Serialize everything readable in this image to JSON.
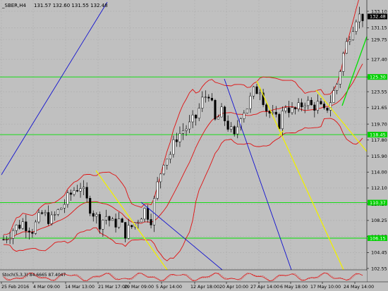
{
  "window": {
    "symbol_header": "_SBER,H4",
    "ohlc": "131.57 132.60 131.55 132.48",
    "current_price_label": "132.48"
  },
  "colors": {
    "background": "#c0c0c0",
    "grid": "#a9a9a9",
    "bull_candle": "#ffffff",
    "bear_candle": "#000000",
    "bollinger": "#e01010",
    "horizontal_levels": "#00e000",
    "trendline_blue": "#1010d0",
    "trendline_yellow": "#f0f000",
    "trendline_green": "#00e000",
    "price_label_bg": "#000000",
    "level_label_bg": "#00d000"
  },
  "price_axis": {
    "ticks": [
      "133.10",
      "131.15",
      "129.75",
      "127.40",
      "125.30",
      "123.55",
      "121.65",
      "119.70",
      "117.80",
      "115.90",
      "114.00",
      "112.10",
      "110.20",
      "108.25",
      "106.35",
      "104.45",
      "102.55"
    ],
    "level_labels": [
      "125.30",
      "118.45",
      "110.37",
      "106.15"
    ]
  },
  "time_axis": {
    "labels": [
      "25 Feb 2016",
      "4 Mar 09:00",
      "14 Mar 13:00",
      "21 Mar 17:00",
      "29 Mar 09:00",
      "5 Apr 14:00",
      "12 Apr 18:00",
      "20 Apr 10:00",
      "27 Apr 14:00",
      "6 May 18:00",
      "17 May 10:00",
      "24 May 14:00"
    ]
  },
  "subwindow": {
    "title": "Stoch(5,3,3) 84.6665 87.4047"
  },
  "chart_data": {
    "type": "candlestick",
    "title": "_SBER,H4",
    "ylim": [
      102.0,
      135.0
    ],
    "y_ticks": [
      133.1,
      131.15,
      129.75,
      127.4,
      125.3,
      123.55,
      121.65,
      119.7,
      117.8,
      115.9,
      114.0,
      112.1,
      110.2,
      108.25,
      106.35,
      104.45,
      102.55
    ],
    "horizontal_levels": [
      125.3,
      118.45,
      110.37,
      106.15
    ],
    "last_price": 132.48,
    "close_path": [
      [
        0,
        106.0
      ],
      [
        3,
        107.2
      ],
      [
        6,
        108.0
      ],
      [
        9,
        107.2
      ],
      [
        12,
        109.0
      ],
      [
        15,
        108.3
      ],
      [
        18,
        109.8
      ],
      [
        20,
        110.8
      ],
      [
        22,
        111.9
      ],
      [
        24,
        112.4
      ],
      [
        26,
        110.5
      ],
      [
        28,
        109.2
      ],
      [
        30,
        108.0
      ],
      [
        32,
        108.8
      ],
      [
        34,
        107.8
      ],
      [
        36,
        108.2
      ],
      [
        38,
        106.8
      ],
      [
        40,
        107.5
      ],
      [
        42,
        108.5
      ],
      [
        44,
        109.5
      ],
      [
        46,
        108.5
      ],
      [
        48,
        112.5
      ],
      [
        50,
        115.5
      ],
      [
        52,
        116.2
      ],
      [
        54,
        118.2
      ],
      [
        56,
        119.0
      ],
      [
        58,
        119.5
      ],
      [
        60,
        120.5
      ],
      [
        62,
        122.5
      ],
      [
        64,
        123.5
      ],
      [
        66,
        120.0
      ],
      [
        68,
        121.0
      ],
      [
        70,
        119.5
      ],
      [
        72,
        118.0
      ],
      [
        74,
        121.0
      ],
      [
        76,
        121.8
      ],
      [
        78,
        123.5
      ],
      [
        80,
        124.0
      ],
      [
        82,
        121.5
      ],
      [
        84,
        120.5
      ],
      [
        86,
        119.8
      ],
      [
        88,
        122.0
      ],
      [
        90,
        121.2
      ],
      [
        92,
        121.5
      ],
      [
        94,
        122.5
      ],
      [
        96,
        121.8
      ],
      [
        98,
        122.0
      ],
      [
        100,
        121.0
      ],
      [
        102,
        122.5
      ],
      [
        104,
        124.5
      ],
      [
        106,
        128.0
      ],
      [
        108,
        130.5
      ],
      [
        110,
        132.5
      ]
    ],
    "bollinger_bands": true,
    "grid": true,
    "legend": "none"
  }
}
